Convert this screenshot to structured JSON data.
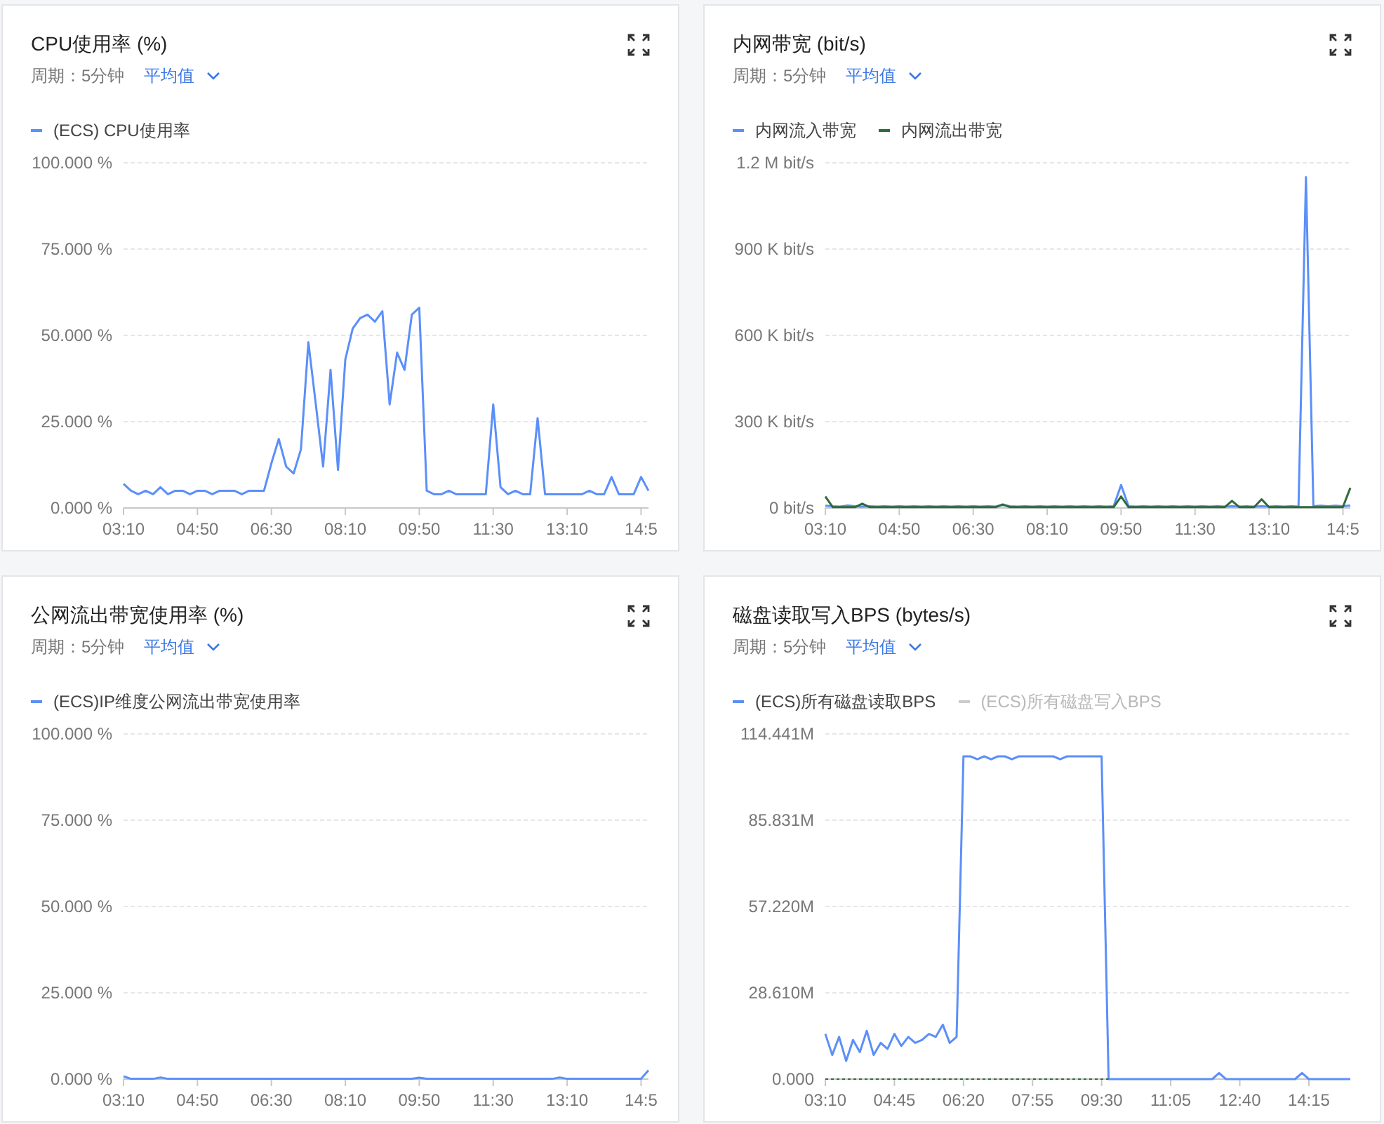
{
  "panels": [
    {
      "title": "CPU使用率 (%)",
      "period": "周期：5分钟",
      "aggregate": "平均值",
      "chart_data": {
        "type": "line",
        "grid": true,
        "ylim": [
          0,
          100
        ],
        "yticks": [
          {
            "value": 0,
            "label": "0.000 %"
          },
          {
            "value": 25,
            "label": "25.000 %"
          },
          {
            "value": 50,
            "label": "50.000 %"
          },
          {
            "value": 75,
            "label": "75.000 %"
          },
          {
            "value": 100,
            "label": "100.000 %"
          }
        ],
        "categories": [
          "03:10",
          null,
          null,
          null,
          null,
          null,
          null,
          null,
          null,
          null,
          "04:50",
          null,
          null,
          null,
          null,
          null,
          null,
          null,
          null,
          null,
          "06:30",
          null,
          null,
          null,
          null,
          null,
          null,
          null,
          null,
          null,
          "08:10",
          null,
          null,
          null,
          null,
          null,
          null,
          null,
          null,
          null,
          "09:50",
          null,
          null,
          null,
          null,
          null,
          null,
          null,
          null,
          null,
          "11:30",
          null,
          null,
          null,
          null,
          null,
          null,
          null,
          null,
          null,
          "13:10",
          null,
          null,
          null,
          null,
          null,
          null,
          null,
          null,
          null,
          "14:5",
          null
        ],
        "series": [
          {
            "name": "(ECS) CPU使用率",
            "color": "#5b8ff9",
            "values": [
              7,
              5,
              4,
              5,
              4,
              6,
              4,
              5,
              5,
              4,
              5,
              5,
              4,
              5,
              5,
              5,
              4,
              5,
              5,
              5,
              13,
              20,
              12,
              10,
              17,
              48,
              30,
              12,
              40,
              11,
              43,
              52,
              55,
              56,
              54,
              57,
              30,
              45,
              40,
              56,
              58,
              5,
              4,
              4,
              5,
              4,
              4,
              4,
              4,
              4,
              30,
              6,
              4,
              5,
              4,
              4,
              26,
              4,
              4,
              4,
              4,
              4,
              4,
              5,
              4,
              4,
              9,
              4,
              4,
              4,
              9,
              5
            ]
          }
        ]
      }
    },
    {
      "title": "内网带宽 (bit/s)",
      "period": "周期：5分钟",
      "aggregate": "平均值",
      "chart_data": {
        "type": "line",
        "grid": true,
        "ylim": [
          0,
          1200000
        ],
        "yticks": [
          {
            "value": 0,
            "label": "0  bit/s"
          },
          {
            "value": 300000,
            "label": "300 K bit/s"
          },
          {
            "value": 600000,
            "label": "600 K bit/s"
          },
          {
            "value": 900000,
            "label": "900 K bit/s"
          },
          {
            "value": 1200000,
            "label": "1.2 M bit/s"
          }
        ],
        "categories": [
          "03:10",
          null,
          null,
          null,
          null,
          null,
          null,
          null,
          null,
          null,
          "04:50",
          null,
          null,
          null,
          null,
          null,
          null,
          null,
          null,
          null,
          "06:30",
          null,
          null,
          null,
          null,
          null,
          null,
          null,
          null,
          null,
          "08:10",
          null,
          null,
          null,
          null,
          null,
          null,
          null,
          null,
          null,
          "09:50",
          null,
          null,
          null,
          null,
          null,
          null,
          null,
          null,
          null,
          "11:30",
          null,
          null,
          null,
          null,
          null,
          null,
          null,
          null,
          null,
          "13:10",
          null,
          null,
          null,
          null,
          null,
          null,
          null,
          null,
          null,
          "14:5",
          null
        ],
        "series": [
          {
            "name": "内网流入带宽",
            "color": "#5b8ff9",
            "values": [
              8000,
              6000,
              5000,
              9000,
              6000,
              5000,
              6000,
              5000,
              6000,
              5000,
              6000,
              5000,
              6000,
              5000,
              6000,
              5000,
              6000,
              5000,
              6000,
              5000,
              6000,
              5000,
              6000,
              5000,
              10000,
              6000,
              5000,
              6000,
              5000,
              6000,
              5000,
              6000,
              5000,
              6000,
              5000,
              6000,
              5000,
              6000,
              5000,
              6000,
              80000,
              6000,
              5000,
              6000,
              5000,
              6000,
              5000,
              6000,
              5000,
              6000,
              5000,
              6000,
              5000,
              6000,
              5000,
              6000,
              5000,
              6000,
              5000,
              6000,
              5000,
              6000,
              5000,
              6000,
              5000,
              1150000,
              6000,
              8000,
              6000,
              8000,
              6000,
              9000
            ]
          },
          {
            "name": "内网流出带宽",
            "color": "#2f6b3b",
            "values": [
              40000,
              3000,
              3000,
              3000,
              3000,
              15000,
              3000,
              3000,
              3000,
              3000,
              3000,
              3000,
              3000,
              3000,
              3000,
              3000,
              3000,
              3000,
              3000,
              3000,
              3000,
              3000,
              3000,
              3000,
              12000,
              3000,
              3000,
              3000,
              3000,
              3000,
              3000,
              3000,
              3000,
              3000,
              3000,
              3000,
              3000,
              3000,
              3000,
              3000,
              40000,
              3000,
              3000,
              3000,
              3000,
              3000,
              3000,
              3000,
              3000,
              3000,
              3000,
              3000,
              3000,
              3000,
              3000,
              25000,
              3000,
              3000,
              3000,
              30000,
              3000,
              3000,
              3000,
              3000,
              3000,
              3000,
              3000,
              3000,
              3000,
              3000,
              3000,
              70000
            ]
          }
        ]
      }
    },
    {
      "title": "公网流出带宽使用率 (%)",
      "period": "周期：5分钟",
      "aggregate": "平均值",
      "chart_data": {
        "type": "line",
        "grid": true,
        "ylim": [
          0,
          100
        ],
        "yticks": [
          {
            "value": 0,
            "label": "0.000 %"
          },
          {
            "value": 25,
            "label": "25.000 %"
          },
          {
            "value": 50,
            "label": "50.000 %"
          },
          {
            "value": 75,
            "label": "75.000 %"
          },
          {
            "value": 100,
            "label": "100.000 %"
          }
        ],
        "categories": [
          "03:10",
          null,
          null,
          null,
          null,
          null,
          null,
          null,
          null,
          null,
          "04:50",
          null,
          null,
          null,
          null,
          null,
          null,
          null,
          null,
          null,
          "06:30",
          null,
          null,
          null,
          null,
          null,
          null,
          null,
          null,
          null,
          "08:10",
          null,
          null,
          null,
          null,
          null,
          null,
          null,
          null,
          null,
          "09:50",
          null,
          null,
          null,
          null,
          null,
          null,
          null,
          null,
          null,
          "11:30",
          null,
          null,
          null,
          null,
          null,
          null,
          null,
          null,
          null,
          "13:10",
          null,
          null,
          null,
          null,
          null,
          null,
          null,
          null,
          null,
          "14:5",
          null
        ],
        "series": [
          {
            "name": "(ECS)IP维度公网流出带宽使用率",
            "color": "#5b8ff9",
            "values": [
              0.8,
              0.1,
              0.1,
              0.1,
              0.1,
              0.5,
              0.1,
              0.1,
              0.1,
              0.1,
              0.1,
              0.1,
              0.1,
              0.1,
              0.1,
              0.1,
              0.1,
              0.1,
              0.1,
              0.1,
              0.1,
              0.1,
              0.1,
              0.1,
              0.1,
              0.1,
              0.1,
              0.1,
              0.1,
              0.1,
              0.1,
              0.1,
              0.1,
              0.1,
              0.1,
              0.1,
              0.1,
              0.1,
              0.1,
              0.1,
              0.4,
              0.1,
              0.1,
              0.1,
              0.1,
              0.1,
              0.1,
              0.1,
              0.1,
              0.1,
              0.1,
              0.1,
              0.1,
              0.1,
              0.1,
              0.1,
              0.1,
              0.1,
              0.1,
              0.5,
              0.1,
              0.1,
              0.1,
              0.1,
              0.1,
              0.1,
              0.1,
              0.1,
              0.1,
              0.1,
              0.1,
              2.5
            ]
          }
        ]
      }
    },
    {
      "title": "磁盘读取写入BPS (bytes/s)",
      "period": "周期：5分钟",
      "aggregate": "平均值",
      "chart_data": {
        "type": "line",
        "grid": true,
        "ylim": [
          0,
          114441000
        ],
        "yticks": [
          {
            "value": 0,
            "label": "0.000"
          },
          {
            "value": 28610000,
            "label": "28.610M"
          },
          {
            "value": 57220000,
            "label": "57.220M"
          },
          {
            "value": 85831000,
            "label": "85.831M"
          },
          {
            "value": 114441000,
            "label": "114.441M"
          }
        ],
        "categories": [
          "03:10",
          null,
          null,
          null,
          null,
          null,
          null,
          null,
          null,
          null,
          "04:45",
          null,
          null,
          null,
          null,
          null,
          null,
          null,
          null,
          null,
          "06:20",
          null,
          null,
          null,
          null,
          null,
          null,
          null,
          null,
          null,
          "07:55",
          null,
          null,
          null,
          null,
          null,
          null,
          null,
          null,
          null,
          "09:30",
          null,
          null,
          null,
          null,
          null,
          null,
          null,
          null,
          null,
          "11:05",
          null,
          null,
          null,
          null,
          null,
          null,
          null,
          null,
          null,
          "12:40",
          null,
          null,
          null,
          null,
          null,
          null,
          null,
          null,
          null,
          "14:15",
          null,
          null,
          null,
          null,
          null,
          null
        ],
        "series": [
          {
            "name": "(ECS)所有磁盘读取BPS",
            "color": "#5b8ff9",
            "values": [
              15000000,
              8000000,
              14000000,
              6000000,
              13000000,
              9000000,
              16000000,
              8000000,
              12000000,
              10000000,
              15000000,
              11000000,
              14000000,
              12000000,
              13000000,
              15000000,
              14000000,
              18000000,
              12000000,
              14000000,
              107000000,
              107000000,
              106000000,
              107000000,
              106000000,
              107000000,
              107000000,
              106000000,
              107000000,
              107000000,
              107000000,
              107000000,
              107000000,
              107000000,
              106000000,
              107000000,
              107000000,
              107000000,
              107000000,
              107000000,
              107000000,
              0,
              0,
              0,
              0,
              0,
              0,
              0,
              0,
              0,
              0,
              0,
              0,
              0,
              0,
              0,
              0,
              2000000,
              0,
              0,
              0,
              0,
              0,
              0,
              0,
              0,
              0,
              0,
              0,
              2000000,
              0,
              0,
              0,
              0,
              0,
              0,
              0
            ]
          },
          {
            "name": "(ECS)所有磁盘写入BPS",
            "color": "#2f6b3b",
            "line_style": "dashed",
            "values": [
              0,
              0,
              0,
              0,
              0,
              0,
              0,
              0,
              0,
              0,
              0,
              0,
              0,
              0,
              0,
              0,
              0,
              0,
              0,
              0,
              0,
              0,
              0,
              0,
              0,
              0,
              0,
              0,
              0,
              0,
              0,
              0,
              0,
              0,
              0,
              0,
              0,
              0,
              0,
              0,
              0,
              0,
              null,
              null,
              null,
              null,
              null,
              null,
              null,
              null,
              null,
              null,
              null,
              null,
              null,
              null,
              null,
              null,
              null,
              null,
              null,
              null,
              null,
              null,
              null,
              null,
              null,
              null,
              null,
              null,
              null,
              null,
              null,
              null,
              null,
              null,
              null
            ]
          }
        ]
      },
      "legend": [
        {
          "selected": true
        },
        {
          "selected": false
        }
      ]
    }
  ]
}
